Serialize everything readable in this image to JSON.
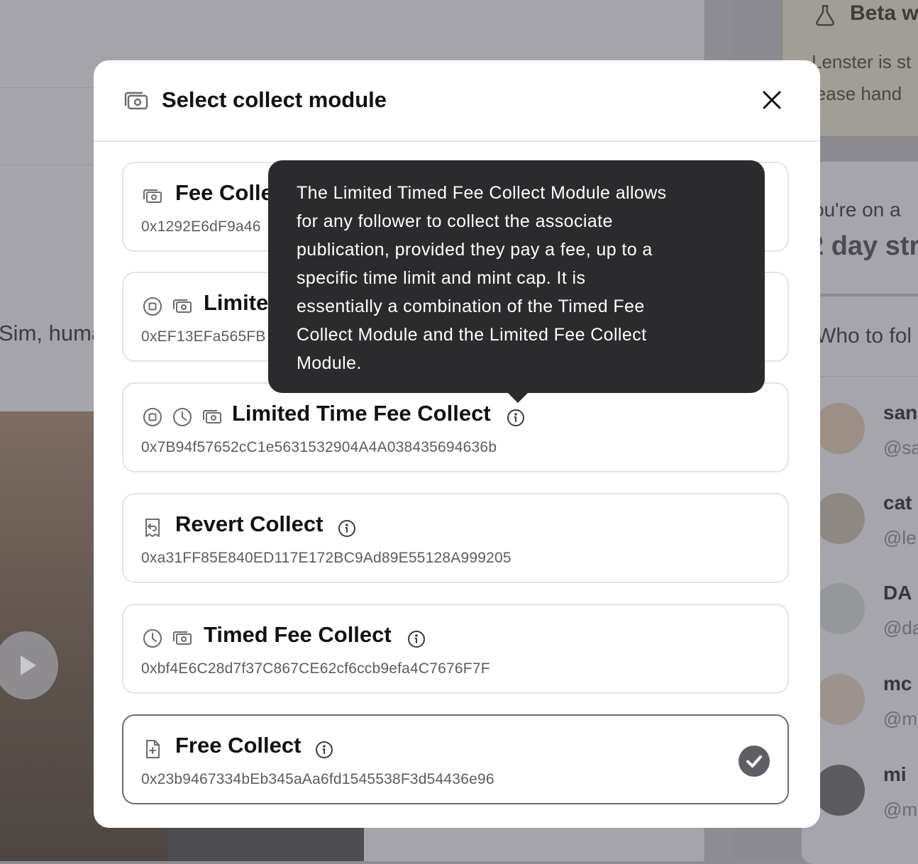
{
  "background": {
    "feed_snippet": "Sim, huma",
    "beta_card": {
      "title": "Beta w",
      "line1": "Lenster is st",
      "line2": "lease hand"
    },
    "streak_card": {
      "line1": "ou're on a",
      "line2": "2 day str"
    },
    "who_to_follow": {
      "title": "Who to fol",
      "people": [
        {
          "name": "san",
          "handle": "@sa"
        },
        {
          "name": "cat",
          "handle": "@le"
        },
        {
          "name": "DA",
          "handle": "@da"
        },
        {
          "name": "mc",
          "handle": "@m"
        },
        {
          "name": "mi",
          "handle": "@m"
        }
      ]
    }
  },
  "modal": {
    "title": "Select collect module",
    "header_icon": "cash-icon",
    "close_icon": "close-icon",
    "modules": [
      {
        "title": "Fee Colle",
        "address": "0x1292E6dF9a46",
        "icons": [
          "cash-icon"
        ],
        "selected": false
      },
      {
        "title": "Limite",
        "address": "0xEF13EFa565FB",
        "icons": [
          "stop-circle-icon",
          "cash-icon"
        ],
        "selected": false
      },
      {
        "title": "Limited Time Fee Collect",
        "address": "0x7B94f57652cC1e5631532904A4A038435694636b",
        "icons": [
          "stop-circle-icon",
          "clock-icon",
          "cash-icon"
        ],
        "selected": false
      },
      {
        "title": "Revert Collect",
        "address": "0xa31FF85E840ED117E172BC9Ad89E55128A999205",
        "icons": [
          "receipt-refund-icon"
        ],
        "selected": false
      },
      {
        "title": "Timed Fee Collect",
        "address": "0xbf4E6C28d7f37C867CE62cf6ccb9efa4C7676F7F",
        "icons": [
          "clock-icon",
          "cash-icon"
        ],
        "selected": false
      },
      {
        "title": "Free Collect",
        "address": "0x23b9467334bEb345aAa6fd1545538F3d54436e96",
        "icons": [
          "document-add-icon"
        ],
        "selected": true
      }
    ]
  },
  "tooltip": {
    "lines": [
      "The Limited Timed Fee Collect Module allows",
      "for any follower to collect the associate",
      "publication, provided they pay a fee, up to a",
      "specific time limit and mint cap. It is",
      "essentially a combination of the Timed Fee",
      "Collect Module and the Limited Fee Collect",
      "Module."
    ]
  },
  "colors": {
    "overlay": "#8d8d93",
    "modal_bg": "#ffffff",
    "tooltip_bg": "#2b2b2e",
    "card_border": "#e3e3e8",
    "selected_border": "#6b6b72",
    "check_bg": "#5e5e64",
    "address_text": "#5b5b62"
  }
}
